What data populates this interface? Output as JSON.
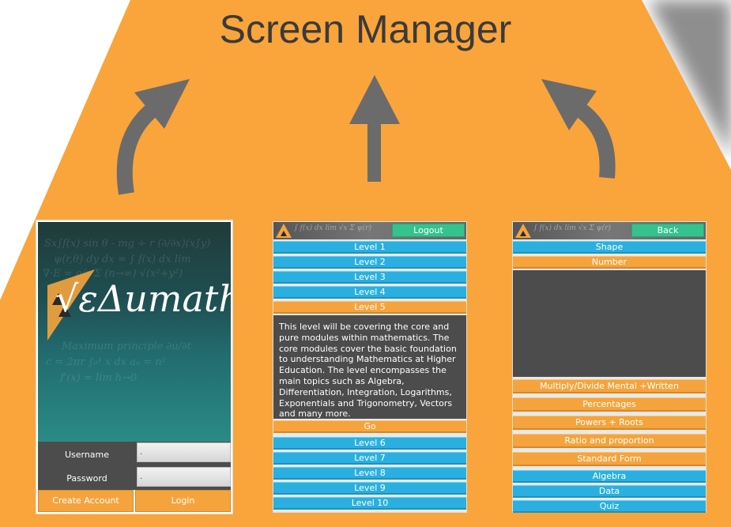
{
  "title": "Screen Manager",
  "colors": {
    "background": "#f9a53b",
    "accent_blue": "#29b0e0",
    "accent_orange": "#f5a43d",
    "accent_green": "#35c28f",
    "panel_dark": "#4c4c4c",
    "arrow_gray": "#6b6b6b"
  },
  "login_screen": {
    "logo_text": "√εΔumath",
    "username_label": "Username",
    "password_label": "Password",
    "username_value": ".",
    "password_value": ".",
    "create_account_label": "Create Account",
    "login_label": "Login"
  },
  "level_screen": {
    "logout_label": "Logout",
    "levels_before": [
      "Level 1",
      "Level 2",
      "Level 3",
      "Level 4"
    ],
    "selected_level": "Level 5",
    "description": "This level will be covering the core and pure modules within mathematics. The core modules cover the basic foundation to understanding Mathematics at Higher Education. The level encompasses the main topics such as Algebra, Differentiation, Integration, Logarithms, Exponentials and Trigonometry, Vectors and many more.",
    "go_label": "Go",
    "levels_after": [
      "Level 6",
      "Level 7",
      "Level 8",
      "Level 9",
      "Level 10"
    ]
  },
  "topic_screen": {
    "back_label": "Back",
    "category_shape": "Shape",
    "category_number": "Number",
    "number_topics": [
      "Multiply/Divide Mental +Written",
      "Percentages",
      "Powers + Roots",
      "Ratio and proportion",
      "Standard Form"
    ],
    "categories_after": [
      "Algebra",
      "Data",
      "Quiz"
    ]
  }
}
